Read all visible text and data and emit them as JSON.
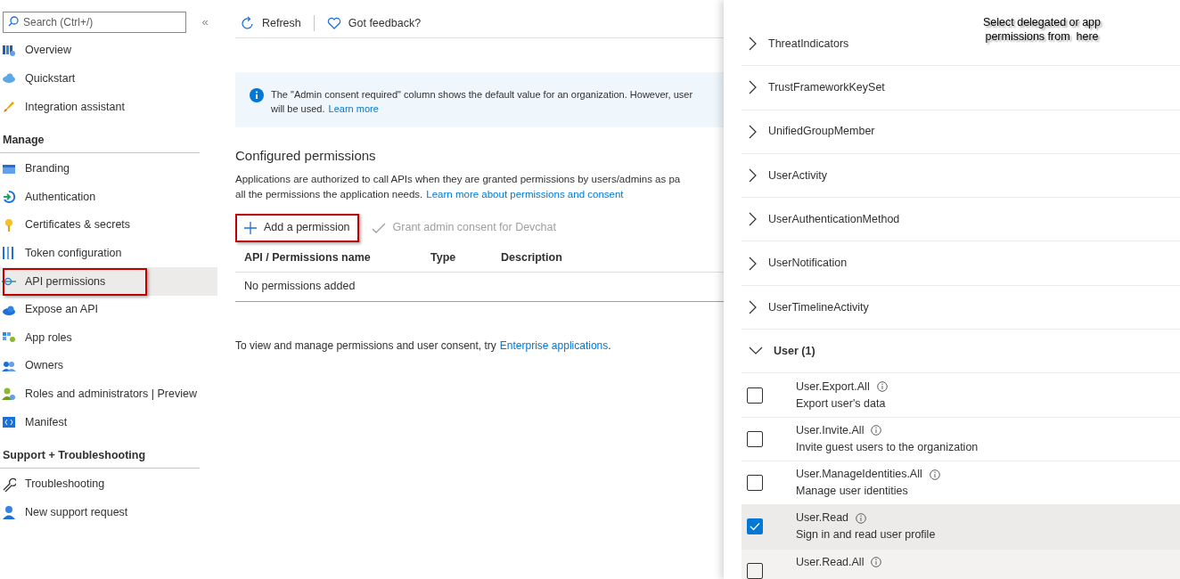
{
  "sidebar": {
    "search": {
      "placeholder": "Search (Ctrl+/)"
    },
    "collapse": "«",
    "sections": [
      {
        "items": [
          {
            "label": "Overview",
            "selected": false,
            "highlighted": false
          },
          {
            "label": "Quickstart",
            "selected": false,
            "highlighted": false
          },
          {
            "label": "Integration assistant",
            "selected": false,
            "highlighted": false
          }
        ]
      },
      {
        "title": "Manage",
        "items": [
          {
            "label": "Branding",
            "selected": false,
            "highlighted": false
          },
          {
            "label": "Authentication",
            "selected": false,
            "highlighted": false
          },
          {
            "label": "Certificates & secrets",
            "selected": false,
            "highlighted": false
          },
          {
            "label": "Token configuration",
            "selected": false,
            "highlighted": false
          },
          {
            "label": "API permissions",
            "selected": true,
            "highlighted": true
          },
          {
            "label": "Expose an API",
            "selected": false,
            "highlighted": false
          },
          {
            "label": "App roles",
            "selected": false,
            "highlighted": false
          },
          {
            "label": "Owners",
            "selected": false,
            "highlighted": false
          },
          {
            "label": "Roles and administrators | Preview",
            "selected": false,
            "highlighted": false
          },
          {
            "label": "Manifest",
            "selected": false,
            "highlighted": false
          }
        ]
      },
      {
        "title": "Support + Troubleshooting",
        "items": [
          {
            "label": "Troubleshooting",
            "selected": false,
            "highlighted": false
          },
          {
            "label": "New support request",
            "selected": false,
            "highlighted": false
          }
        ]
      }
    ]
  },
  "toolbar": [
    "Refresh",
    "Got feedback?"
  ],
  "info": {
    "text": "The \"Admin consent required\" column shows the default value for an organization. However, user",
    "text_2": "will be used.",
    "link": "Learn more"
  },
  "configured": {
    "title": "Configured permissions",
    "text": "Applications are authorized to call APIs when they are granted permissions by users/admins as pa",
    "text_2": "all the permissions the application needs.",
    "link": "Learn more about permissions and consent"
  },
  "actions": [
    {
      "label": "Add a permission",
      "disabled": false,
      "highlighted": true
    },
    {
      "label": "Grant admin consent for Devchat",
      "disabled": true,
      "highlighted": false
    }
  ],
  "table": {
    "columns": [
      "API / Permissions name",
      "Type",
      "Description"
    ],
    "empty": "No permissions added"
  },
  "footer": {
    "text": "To view and manage permissions and user consent, try",
    "link": "Enterprise applications",
    "end": "."
  },
  "panel": {
    "annotation": "Select delegated or app permissions from  here",
    "groups": [
      {
        "label": "ThreatIndicators",
        "expanded": false
      },
      {
        "label": "TrustFrameworkKeySet",
        "expanded": false
      },
      {
        "label": "UnifiedGroupMember",
        "expanded": false
      },
      {
        "label": "UserActivity",
        "expanded": false
      },
      {
        "label": "UserAuthenticationMethod",
        "expanded": false
      },
      {
        "label": "UserNotification",
        "expanded": false
      },
      {
        "label": "UserTimelineActivity",
        "expanded": false
      },
      {
        "label": "User (1)",
        "expanded": true,
        "permissions": [
          {
            "name": "User.Export.All",
            "description": "Export user's data",
            "checked": false
          },
          {
            "name": "User.Invite.All",
            "description": "Invite guest users to the organization",
            "checked": false
          },
          {
            "name": "User.ManageIdentities.All",
            "description": "Manage user identities",
            "checked": false
          },
          {
            "name": "User.Read",
            "description": "Sign in and read user profile",
            "checked": true
          },
          {
            "name": "User.Read.All",
            "checked": false
          }
        ]
      }
    ]
  }
}
